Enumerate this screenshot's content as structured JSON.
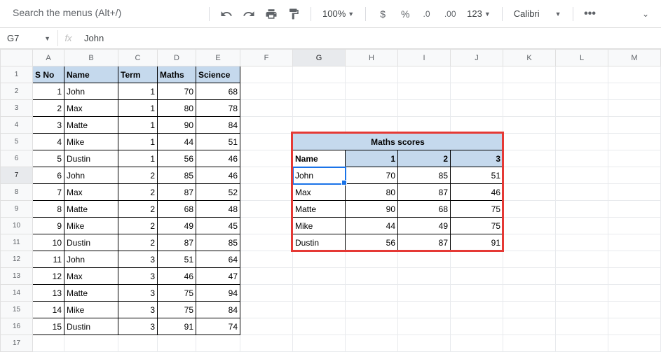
{
  "toolbar": {
    "search_placeholder": "Search the menus (Alt+/)",
    "zoom": "100%",
    "font": "Calibri",
    "format123": "123"
  },
  "namebox": "G7",
  "formula": "John",
  "colHeaders": [
    "A",
    "B",
    "C",
    "D",
    "E",
    "F",
    "G",
    "H",
    "I",
    "J",
    "K",
    "L",
    "M"
  ],
  "mainHdr": {
    "sno": "S No",
    "name": "Name",
    "term": "Term",
    "maths": "Maths",
    "science": "Science"
  },
  "mainRows": [
    {
      "sno": 1,
      "name": "John",
      "term": 1,
      "m": 70,
      "s": 68
    },
    {
      "sno": 2,
      "name": "Max",
      "term": 1,
      "m": 80,
      "s": 78
    },
    {
      "sno": 3,
      "name": "Matte",
      "term": 1,
      "m": 90,
      "s": 84
    },
    {
      "sno": 4,
      "name": "Mike",
      "term": 1,
      "m": 44,
      "s": 51
    },
    {
      "sno": 5,
      "name": "Dustin",
      "term": 1,
      "m": 56,
      "s": 46
    },
    {
      "sno": 6,
      "name": "John",
      "term": 2,
      "m": 85,
      "s": 46
    },
    {
      "sno": 7,
      "name": "Max",
      "term": 2,
      "m": 87,
      "s": 52
    },
    {
      "sno": 8,
      "name": "Matte",
      "term": 2,
      "m": 68,
      "s": 48
    },
    {
      "sno": 9,
      "name": "Mike",
      "term": 2,
      "m": 49,
      "s": 45
    },
    {
      "sno": 10,
      "name": "Dustin",
      "term": 2,
      "m": 87,
      "s": 85
    },
    {
      "sno": 11,
      "name": "John",
      "term": 3,
      "m": 51,
      "s": 64
    },
    {
      "sno": 12,
      "name": "Max",
      "term": 3,
      "m": 46,
      "s": 47
    },
    {
      "sno": 13,
      "name": "Matte",
      "term": 3,
      "m": 75,
      "s": 94
    },
    {
      "sno": 14,
      "name": "Mike",
      "term": 3,
      "m": 75,
      "s": 84
    },
    {
      "sno": 15,
      "name": "Dustin",
      "term": 3,
      "m": 91,
      "s": 74
    }
  ],
  "pivot": {
    "title": "Maths scores",
    "nameH": "Name",
    "cols": [
      1,
      2,
      3
    ],
    "rows": [
      {
        "name": "John",
        "v": [
          70,
          85,
          51
        ]
      },
      {
        "name": "Max",
        "v": [
          80,
          87,
          46
        ]
      },
      {
        "name": "Matte",
        "v": [
          90,
          68,
          75
        ]
      },
      {
        "name": "Mike",
        "v": [
          44,
          49,
          75
        ]
      },
      {
        "name": "Dustin",
        "v": [
          56,
          87,
          91
        ]
      }
    ]
  },
  "chart_data": {
    "type": "table",
    "title": "Maths scores",
    "categories": [
      1,
      2,
      3
    ],
    "series": [
      {
        "name": "John",
        "values": [
          70,
          85,
          51
        ]
      },
      {
        "name": "Max",
        "values": [
          80,
          87,
          46
        ]
      },
      {
        "name": "Matte",
        "values": [
          90,
          68,
          75
        ]
      },
      {
        "name": "Mike",
        "values": [
          44,
          49,
          75
        ]
      },
      {
        "name": "Dustin",
        "values": [
          56,
          87,
          91
        ]
      }
    ]
  }
}
